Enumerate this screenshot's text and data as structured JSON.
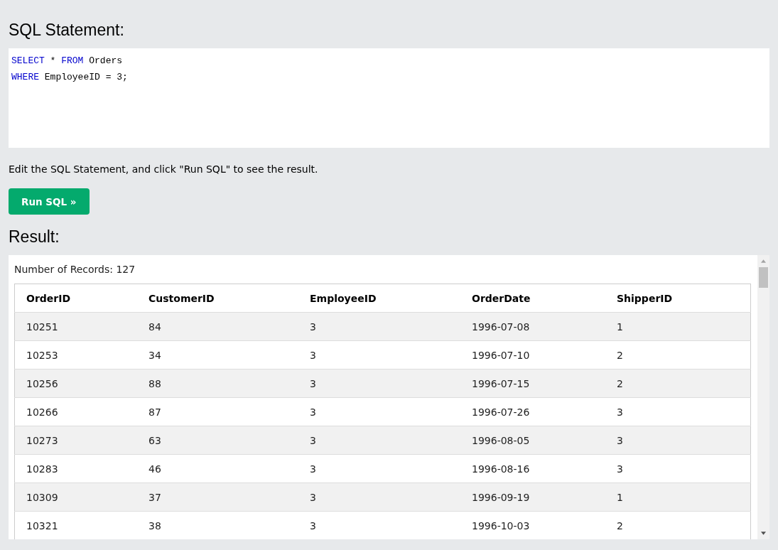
{
  "editor": {
    "title": "SQL Statement:",
    "lines": [
      [
        {
          "kind": "keyword",
          "text": "SELECT"
        },
        {
          "kind": "plain",
          "text": " * "
        },
        {
          "kind": "keyword",
          "text": "FROM"
        },
        {
          "kind": "plain",
          "text": " Orders"
        }
      ],
      [
        {
          "kind": "keyword",
          "text": "WHERE"
        },
        {
          "kind": "plain",
          "text": " EmployeeID = 3;"
        }
      ]
    ]
  },
  "instruction": "Edit the SQL Statement, and click \"Run SQL\" to see the result.",
  "run_button": "Run SQL »",
  "result": {
    "title": "Result:",
    "record_count": "Number of Records: 127",
    "table": {
      "columns": [
        "OrderID",
        "CustomerID",
        "EmployeeID",
        "OrderDate",
        "ShipperID"
      ],
      "rows": [
        [
          "10251",
          "84",
          "3",
          "1996-07-08",
          "1"
        ],
        [
          "10253",
          "34",
          "3",
          "1996-07-10",
          "2"
        ],
        [
          "10256",
          "88",
          "3",
          "1996-07-15",
          "2"
        ],
        [
          "10266",
          "87",
          "3",
          "1996-07-26",
          "3"
        ],
        [
          "10273",
          "63",
          "3",
          "1996-08-05",
          "3"
        ],
        [
          "10283",
          "46",
          "3",
          "1996-08-16",
          "3"
        ],
        [
          "10309",
          "37",
          "3",
          "1996-09-19",
          "1"
        ],
        [
          "10321",
          "38",
          "3",
          "1996-10-03",
          "2"
        ]
      ]
    }
  }
}
